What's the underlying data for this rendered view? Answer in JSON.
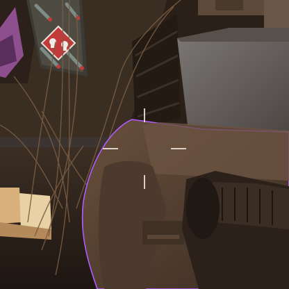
{
  "scene": {
    "view": "first-person",
    "held_item_outline_color": "#b15cff",
    "palette": {
      "wall_dark": "#2a2018",
      "wall_mid": "#4a3a2c",
      "floor": "#3b2e23",
      "light_panel": "#6e6b6a",
      "held_item": "#5a4434",
      "held_item_dark": "#2e241c",
      "poster_bg": "#3c3a34",
      "poster_accent": "#c23a3a",
      "crosshair": "#e8e2da"
    }
  },
  "poster": {
    "icon": "skull-hazard-icon"
  },
  "hud": {
    "crosshair_icon": "crosshair-icon"
  }
}
